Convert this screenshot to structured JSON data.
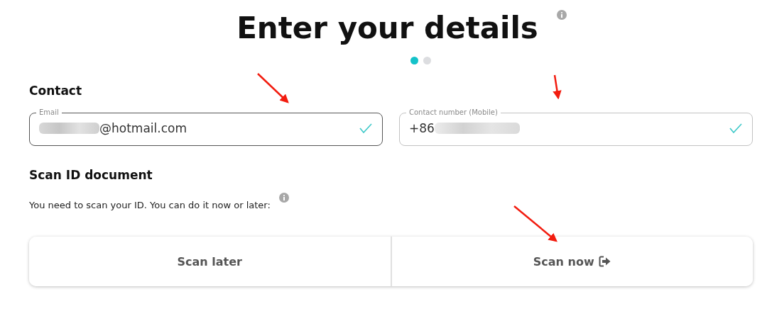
{
  "title": "Enter your details",
  "steps": [
    {
      "selected": true
    },
    {
      "selected": false
    }
  ],
  "contact": {
    "heading": "Contact",
    "fields": [
      {
        "label": "Email",
        "value": "@hotmail.com",
        "focused": true,
        "valid": true
      },
      {
        "label": "Contact number (Mobile)",
        "value": "+86",
        "focused": false,
        "valid": true
      }
    ]
  },
  "scan": {
    "heading": "Scan ID document",
    "text": "You need to scan your ID. You can do it now or later:",
    "buttons": [
      {
        "label": "Scan later",
        "kind": "plain"
      },
      {
        "label": "Scan now",
        "kind": "exit"
      }
    ]
  }
}
